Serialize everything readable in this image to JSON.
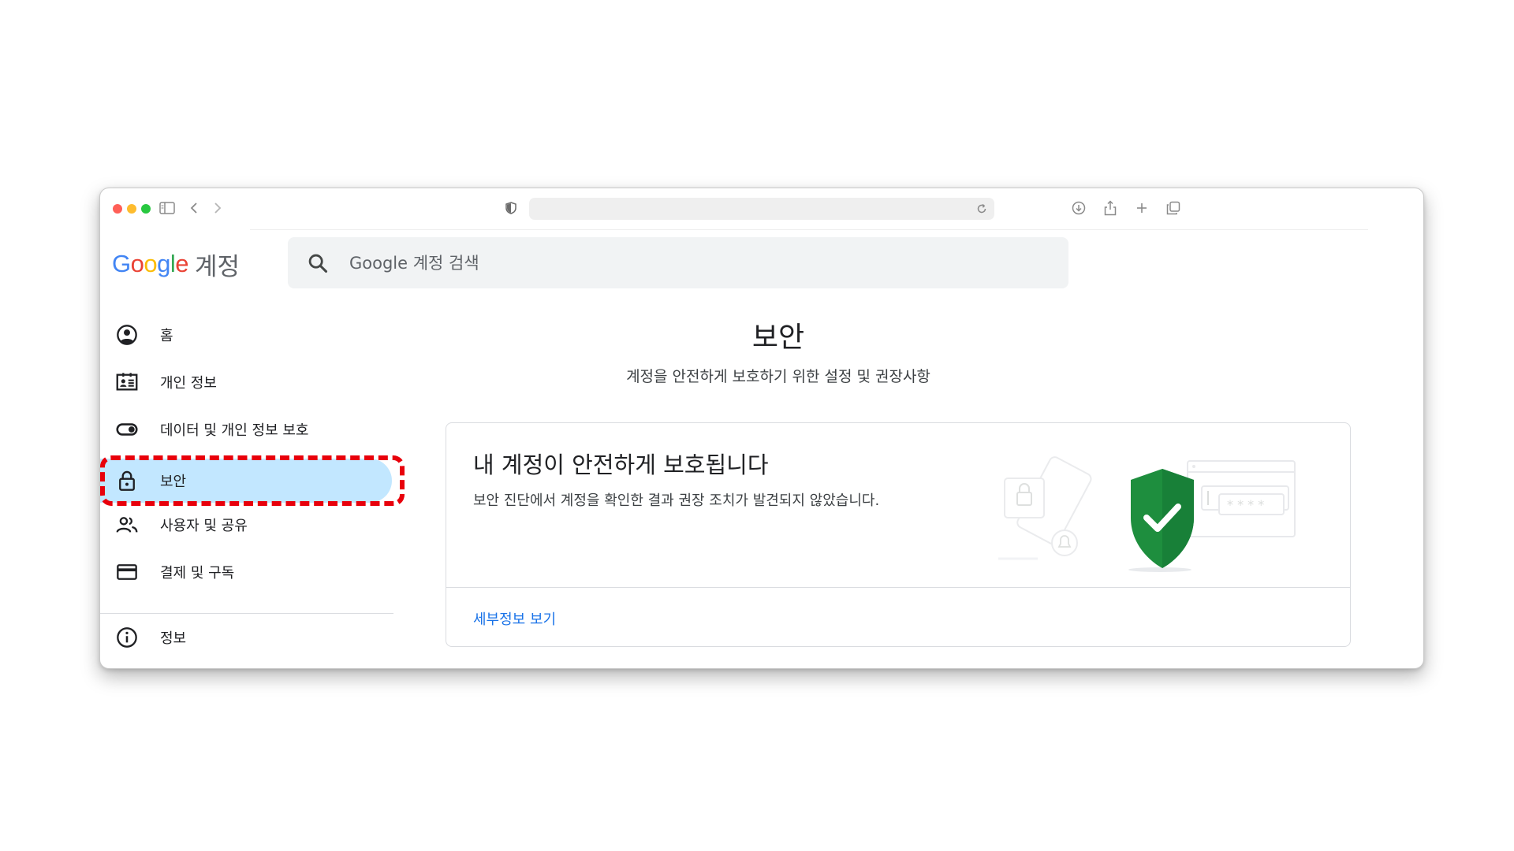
{
  "browser": {
    "traffic_colors": {
      "close": "#ff5f57",
      "minimize": "#febc2e",
      "maximize": "#28c840"
    },
    "icons": [
      "sidebar-icon",
      "back-icon",
      "forward-icon",
      "shield-icon",
      "reload-icon",
      "download-icon",
      "share-icon",
      "new-tab-icon",
      "tabs-overview-icon"
    ]
  },
  "header": {
    "logo_text": "Google",
    "account_label": "계정",
    "search_placeholder": "Google 계정 검색"
  },
  "sidebar": {
    "items": [
      {
        "label": "홈",
        "icon": "account-circle-icon"
      },
      {
        "label": "개인 정보",
        "icon": "id-card-icon"
      },
      {
        "label": "데이터 및 개인 정보 보호",
        "icon": "toggle-icon"
      },
      {
        "label": "보안",
        "icon": "lock-icon",
        "active": true
      },
      {
        "label": "사용자 및 공유",
        "icon": "people-icon"
      },
      {
        "label": "결제 및 구독",
        "icon": "credit-card-icon"
      },
      {
        "label": "정보",
        "icon": "info-icon"
      }
    ],
    "active_color": "#c2e7ff",
    "annotation_color": "#e8000b"
  },
  "main": {
    "title": "보안",
    "subtitle": "계정을 안전하게 보호하기 위한 설정 및 권장사항",
    "card": {
      "title": "내 계정이 안전하게 보호됩니다",
      "description": "보안 진단에서 계정을 확인한 결과 권장 조치가 발견되지 않았습니다.",
      "link": "세부정보 보기",
      "shield_color": "#1e8e3e",
      "link_color": "#1a73e8"
    }
  }
}
